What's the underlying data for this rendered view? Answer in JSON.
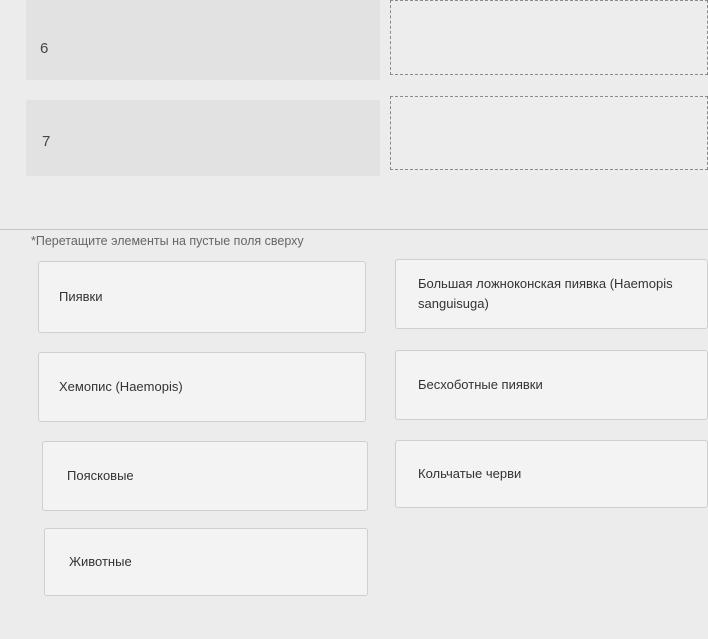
{
  "rows": [
    {
      "number": "6"
    },
    {
      "number": "7"
    }
  ],
  "hint": "*Перетащите элементы на пустые поля сверху",
  "cards": [
    "Пиявки",
    "Большая ложноконская пиявка (Haemopis sanguisuga)",
    "Хемопис (Haemopis)",
    "Бесхоботные пиявки",
    "Поясковые",
    "Кольчатые черви",
    "Животные"
  ]
}
